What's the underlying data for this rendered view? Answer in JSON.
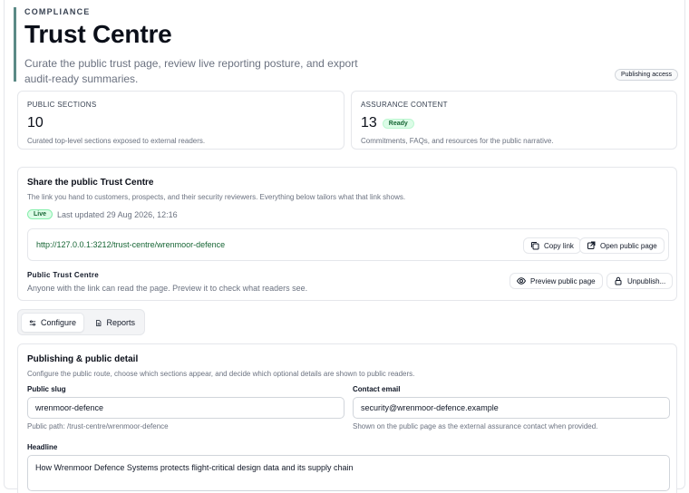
{
  "header": {
    "eyebrow": "COMPLIANCE",
    "title": "Trust Centre",
    "subtitle": "Curate the public trust page, review live reporting posture, and export audit-ready summaries.",
    "access_badge": "Publishing access"
  },
  "stats": [
    {
      "label": "PUBLIC SECTIONS",
      "value": "10",
      "badge": "",
      "desc": "Curated top-level sections exposed to external readers."
    },
    {
      "label": "ASSURANCE CONTENT",
      "value": "13",
      "badge": "Ready",
      "desc": "Commitments, FAQs, and resources for the public narrative."
    }
  ],
  "share": {
    "title": "Share the public Trust Centre",
    "desc": "The link you hand to customers, prospects, and their security reviewers. Everything below tailors what that link shows.",
    "status": "Live",
    "updated": "Last updated 29 Aug 2026, 12:16",
    "url": "http://127.0.0.1:3212/trust-centre/wrenmoor-defence",
    "copy_label": "Copy link",
    "open_label": "Open public page",
    "public_title": "Public Trust Centre",
    "public_desc": "Anyone with the link can read the page. Preview it to check what readers see.",
    "preview_label": "Preview public page",
    "unpublish_label": "Unpublish..."
  },
  "tabs": [
    {
      "label": "Configure",
      "icon": "sliders-icon"
    },
    {
      "label": "Reports",
      "icon": "document-icon"
    }
  ],
  "publishing": {
    "title": "Publishing & public detail",
    "desc": "Configure the public route, choose which sections appear, and decide which optional details are shown to public readers.",
    "slug_label": "Public slug",
    "slug_value": "wrenmoor-defence",
    "slug_hint": "Public path: /trust-centre/wrenmoor-defence",
    "email_label": "Contact email",
    "email_value": "security@wrenmoor-defence.example",
    "email_hint": "Shown on the public page as the external assurance contact when provided.",
    "headline_label": "Headline",
    "headline_value": "How Wrenmoor Defence Systems protects flight-critical design data and its supply chain"
  },
  "colors": {
    "accent": "#5b8a86",
    "live_green": "#166534",
    "border": "#e5e7eb"
  }
}
